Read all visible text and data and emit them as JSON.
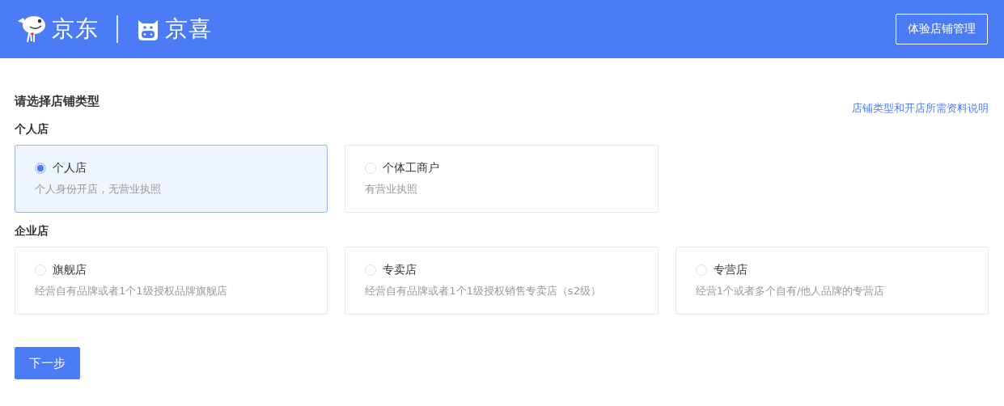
{
  "header": {
    "brand_primary": "京东",
    "brand_secondary": "京喜",
    "action_button": "体验店铺管理"
  },
  "page": {
    "title": "请选择店铺类型",
    "help_link": "店铺类型和开店所需资料说明"
  },
  "sections": [
    {
      "label": "个人店",
      "options": [
        {
          "name": "个人店",
          "description": "个人身份开店，无营业执照",
          "selected": true
        },
        {
          "name": "个体工商户",
          "description": "有营业执照",
          "selected": false
        }
      ]
    },
    {
      "label": "企业店",
      "options": [
        {
          "name": "旗舰店",
          "description": "经营自有品牌或者1个1级授权品牌旗舰店",
          "selected": false
        },
        {
          "name": "专卖店",
          "description": "经营自有品牌或者1个1级授权销售专卖店（s2级）",
          "selected": false
        },
        {
          "name": "专营店",
          "description": "经营1个或者多个自有/他人品牌的专营店",
          "selected": false
        }
      ]
    }
  ],
  "next_button": "下一步"
}
